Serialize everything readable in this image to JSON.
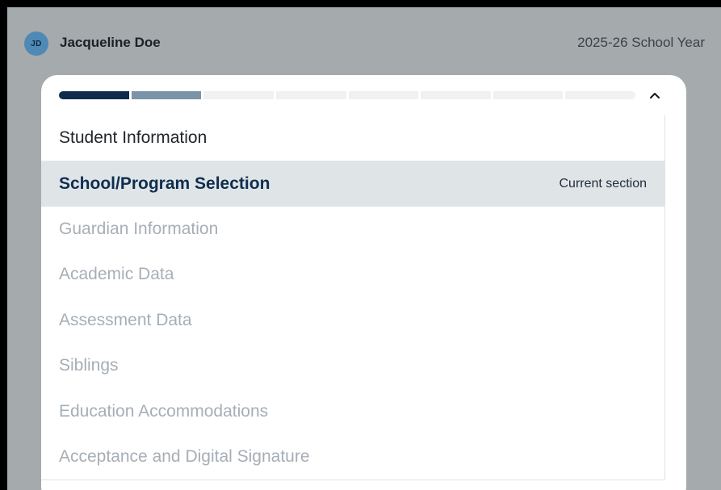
{
  "user": {
    "initials": "JD",
    "name": "Jacqueline Doe"
  },
  "school_year": "2025-26 School Year",
  "progress": {
    "total_steps": 8,
    "completed_steps": 1,
    "current_step": 2
  },
  "sections": [
    {
      "label": "Student Information",
      "state": "completed"
    },
    {
      "label": "School/Program Selection",
      "state": "current"
    },
    {
      "label": "Guardian Information",
      "state": "upcoming"
    },
    {
      "label": "Academic Data",
      "state": "upcoming"
    },
    {
      "label": "Assessment Data",
      "state": "upcoming"
    },
    {
      "label": "Siblings",
      "state": "upcoming"
    },
    {
      "label": "Education Accommodations",
      "state": "upcoming"
    },
    {
      "label": "Acceptance and Digital Signature",
      "state": "upcoming"
    }
  ],
  "current_badge": "Current section",
  "icons": {
    "collapse": "chevron-up-icon"
  },
  "colors": {
    "progress_done": "#0e2b4d",
    "progress_current": "#7b93a8",
    "active_row_bg": "#dfe5e6",
    "avatar_bg": "#4f89b6"
  }
}
